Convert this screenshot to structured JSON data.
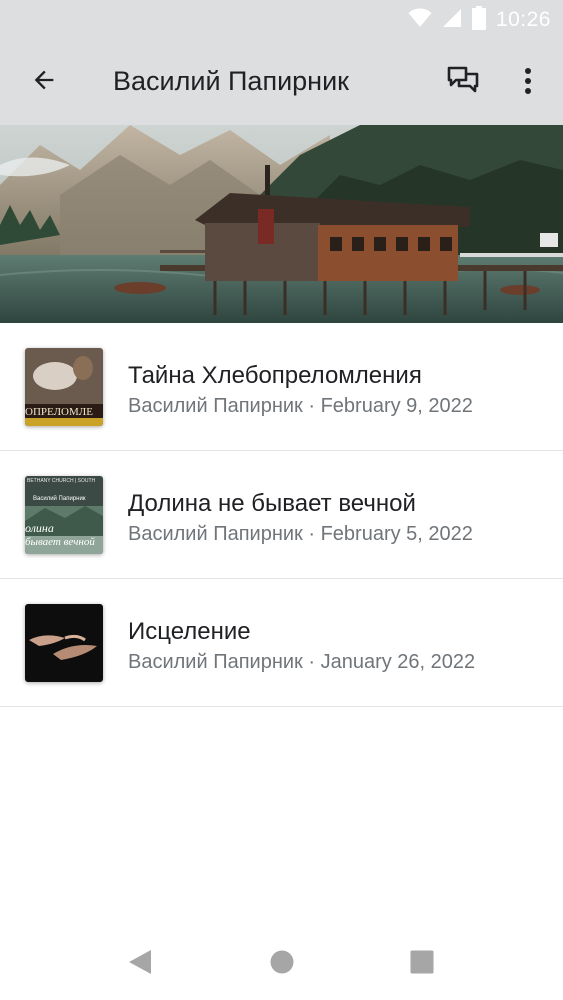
{
  "status_bar": {
    "time": "10:26",
    "icons": [
      "wifi-icon",
      "signal-icon",
      "battery-icon"
    ]
  },
  "app_bar": {
    "title": "Василий Папирник",
    "back_icon": "arrow-left-icon",
    "actions": [
      "chat-icon",
      "more-vert-icon"
    ]
  },
  "hero": {
    "image": "mountain-lake-boathouse"
  },
  "episodes": [
    {
      "title": "Тайна Хлебопреломления",
      "author": "Василий Папирник",
      "separator": "·",
      "date": "February 9, 2022",
      "thumb_text": "ОПРЕЛОМЛЕ"
    },
    {
      "title": "Долина не бывает вечной",
      "author": "Василий Папирник",
      "separator": "·",
      "date": "February 5, 2022",
      "thumb_top": "BETHANY CHURCH | SOUTH",
      "thumb_name": "Василий Папирник",
      "thumb_line1": "олина",
      "thumb_line2": "бывает вечной"
    },
    {
      "title": "Исцеление",
      "author": "Василий Папирник",
      "separator": "·",
      "date": "January 26, 2022"
    }
  ],
  "nav_bar": {
    "buttons": [
      "back-triangle-icon",
      "home-circle-icon",
      "recents-square-icon"
    ]
  },
  "colors": {
    "app_bar": "#dcdedf",
    "title_text": "#202124",
    "meta_text": "#70757a",
    "divider": "#e3e3e3",
    "nav_icon": "#a6a6a6"
  }
}
